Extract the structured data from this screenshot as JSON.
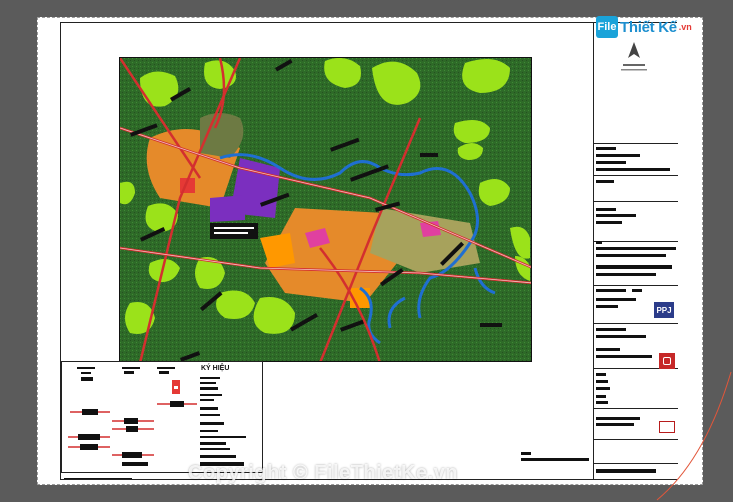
{
  "brand": {
    "logo_text": "File",
    "name": "Thiết Kế",
    "tld": ".vn"
  },
  "watermark": {
    "text": "Copyright © FileThietKe.vn"
  },
  "legend": {
    "title": "KÝ HIỆU"
  },
  "title_block": {
    "firm_logo": "PPJ"
  },
  "colors": {
    "background": "#5b5b5b",
    "forest": "#2f6b2a",
    "light_green": "#9be21a",
    "residential": "#e58a2a",
    "industrial": "#7b2fbf",
    "water": "#1f6fd1",
    "road": "#d32f2f",
    "brand_blue": "#1d8fcf"
  }
}
